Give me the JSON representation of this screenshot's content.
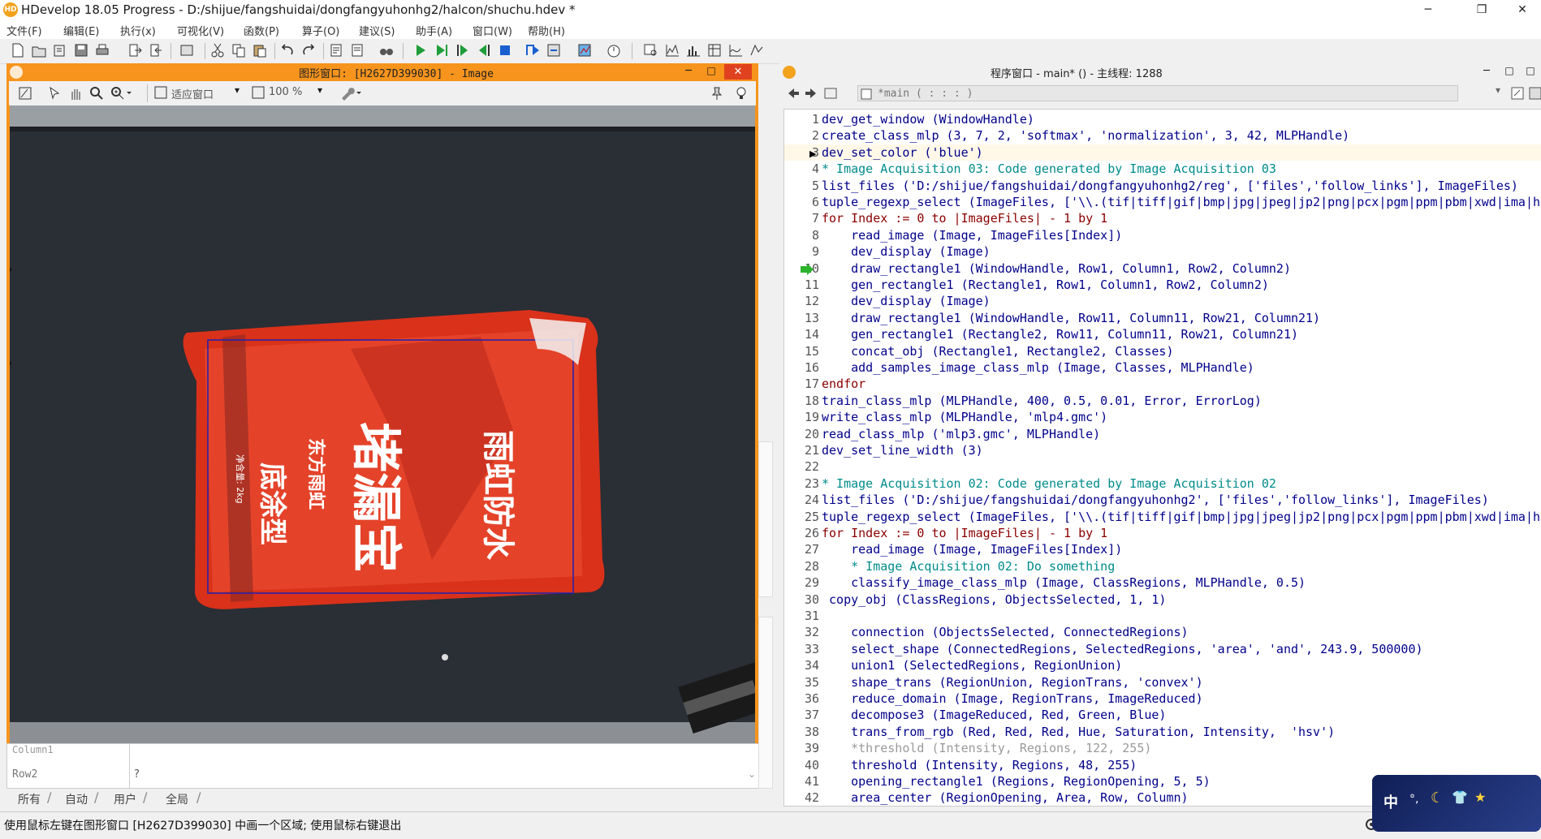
{
  "window": {
    "title": "HDevelop 18.05 Progress - D:/shijue/fangshuidai/dongfangyuhonhg2/halcon/shuchu.hdev *",
    "logo_text": "HD",
    "minimize_glyph": "─",
    "maximize_glyph": "❐",
    "close_glyph": "✕"
  },
  "menu": [
    "文件(F)",
    "编辑(E)",
    "执行(x)",
    "可视化(V)",
    "函数(P)",
    "算子(O)",
    "建议(S)",
    "助手(A)",
    "窗口(W)",
    "帮助(H)"
  ],
  "graphics_window": {
    "title": "图形窗口: [H2627D399030] - Image",
    "zoom_mode": "适应窗口",
    "zoom_percent": "100 %",
    "bag_text_main": "堵漏宝",
    "bag_text_side": "雨虹防水",
    "bag_text_brand": "东方雨虹",
    "bag_text_sub": "底涂型",
    "bag_text_weight": "净含量: 2kg"
  },
  "program_window": {
    "title": "程序窗口 - main* () - 主线程: 1288",
    "procedure": "*main ( : : : )"
  },
  "code_lines": [
    {
      "n": "1",
      "t": "dev_get_window (WindowHandle)",
      "k": ""
    },
    {
      "n": "2",
      "t": "create_class_mlp (3, 7, 2, 'softmax', 'normalization', 3, 42, MLPHandle)",
      "k": ""
    },
    {
      "n": "3",
      "t": "dev_set_color ('blue')",
      "k": ""
    },
    {
      "n": "4",
      "t": "* Image Acquisition 03: Code generated by Image Acquisition 03",
      "k": "cmt"
    },
    {
      "n": "5",
      "t": "list_files ('D:/shijue/fangshuidai/dongfangyuhonhg2/reg', ['files','follow_links'], ImageFiles)",
      "k": ""
    },
    {
      "n": "6",
      "t": "tuple_regexp_select (ImageFiles, ['\\\\.(tif|tiff|gif|bmp|jpg|jpeg|jp2|png|pcx|pgm|ppm|pbm|xwd|ima|h",
      "k": ""
    },
    {
      "n": "7",
      "t": "for Index := 0 to |ImageFiles| - 1 by 1",
      "k": "ctrl"
    },
    {
      "n": "8",
      "t": "    read_image (Image, ImageFiles[Index])",
      "k": ""
    },
    {
      "n": "9",
      "t": "    dev_display (Image)",
      "k": ""
    },
    {
      "n": "10",
      "t": "    draw_rectangle1 (WindowHandle, Row1, Column1, Row2, Column2)",
      "k": ""
    },
    {
      "n": "11",
      "t": "    gen_rectangle1 (Rectangle1, Row1, Column1, Row2, Column2)",
      "k": ""
    },
    {
      "n": "12",
      "t": "    dev_display (Image)",
      "k": ""
    },
    {
      "n": "13",
      "t": "    draw_rectangle1 (WindowHandle, Row11, Column11, Row21, Column21)",
      "k": ""
    },
    {
      "n": "14",
      "t": "    gen_rectangle1 (Rectangle2, Row11, Column11, Row21, Column21)",
      "k": ""
    },
    {
      "n": "15",
      "t": "    concat_obj (Rectangle1, Rectangle2, Classes)",
      "k": ""
    },
    {
      "n": "16",
      "t": "    add_samples_image_class_mlp (Image, Classes, MLPHandle)",
      "k": ""
    },
    {
      "n": "17",
      "t": "endfor",
      "k": "ctrl"
    },
    {
      "n": "18",
      "t": "train_class_mlp (MLPHandle, 400, 0.5, 0.01, Error, ErrorLog)",
      "k": ""
    },
    {
      "n": "19",
      "t": "write_class_mlp (MLPHandle, 'mlp4.gmc')",
      "k": ""
    },
    {
      "n": "20",
      "t": "read_class_mlp ('mlp3.gmc', MLPHandle)",
      "k": ""
    },
    {
      "n": "21",
      "t": "dev_set_line_width (3)",
      "k": ""
    },
    {
      "n": "22",
      "t": "",
      "k": ""
    },
    {
      "n": "23",
      "t": "* Image Acquisition 02: Code generated by Image Acquisition 02",
      "k": "cmt"
    },
    {
      "n": "24",
      "t": "list_files ('D:/shijue/fangshuidai/dongfangyuhonhg2', ['files','follow_links'], ImageFiles)",
      "k": ""
    },
    {
      "n": "25",
      "t": "tuple_regexp_select (ImageFiles, ['\\\\.(tif|tiff|gif|bmp|jpg|jpeg|jp2|png|pcx|pgm|ppm|pbm|xwd|ima|h",
      "k": ""
    },
    {
      "n": "26",
      "t": "for Index := 0 to |ImageFiles| - 1 by 1",
      "k": "ctrl"
    },
    {
      "n": "27",
      "t": "    read_image (Image, ImageFiles[Index])",
      "k": ""
    },
    {
      "n": "28",
      "t": "    * Image Acquisition 02: Do something",
      "k": "cmt"
    },
    {
      "n": "29",
      "t": "    classify_image_class_mlp (Image, ClassRegions, MLPHandle, 0.5)",
      "k": ""
    },
    {
      "n": "30",
      "t": " copy_obj (ClassRegions, ObjectsSelected, 1, 1)",
      "k": ""
    },
    {
      "n": "31",
      "t": "",
      "k": ""
    },
    {
      "n": "32",
      "t": "    connection (ObjectsSelected, ConnectedRegions)",
      "k": ""
    },
    {
      "n": "33",
      "t": "    select_shape (ConnectedRegions, SelectedRegions, 'area', 'and', 243.9, 500000)",
      "k": ""
    },
    {
      "n": "34",
      "t": "    union1 (SelectedRegions, RegionUnion)",
      "k": ""
    },
    {
      "n": "35",
      "t": "    shape_trans (RegionUnion, RegionTrans, 'convex')",
      "k": ""
    },
    {
      "n": "36",
      "t": "    reduce_domain (Image, RegionTrans, ImageReduced)",
      "k": ""
    },
    {
      "n": "37",
      "t": "    decompose3 (ImageReduced, Red, Green, Blue)",
      "k": ""
    },
    {
      "n": "38",
      "t": "    trans_from_rgb (Red, Red, Red, Hue, Saturation, Intensity,  'hsv')",
      "k": ""
    },
    {
      "n": "39",
      "t": "    *threshold (Intensity, Regions, 122, 255)",
      "k": "dis"
    },
    {
      "n": "40",
      "t": "    threshold (Intensity, Regions, 48, 255)",
      "k": ""
    },
    {
      "n": "41",
      "t": "    opening_rectangle1 (Regions, RegionOpening, 5, 5)",
      "k": ""
    },
    {
      "n": "42",
      "t": "    area_center (RegionOpening, Area, Row, Column)",
      "k": ""
    }
  ],
  "variables": {
    "row_label_1": "Column1",
    "row_label_2": "Row2",
    "row_value_2": "?",
    "tabs": [
      "所有",
      "自动",
      "用户",
      "全局"
    ]
  },
  "status_text": "使用鼠标左键在图形窗口 [H2627D399030] 中画一个区域; 使用鼠标右键退出",
  "ime": {
    "label": "中"
  },
  "colors": {
    "accent_orange": "#f7941d",
    "code_blue": "#00008b",
    "comment_teal": "#008b8b"
  }
}
